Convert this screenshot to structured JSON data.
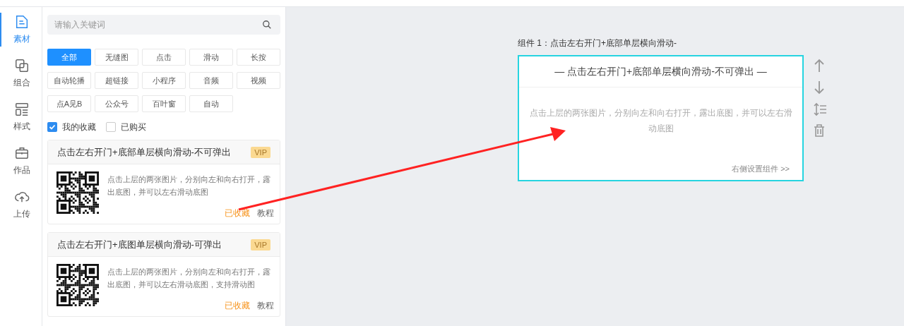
{
  "nav": [
    {
      "label": "素材",
      "selected": true,
      "kind": "file"
    },
    {
      "label": "组合",
      "selected": false,
      "kind": "combine"
    },
    {
      "label": "样式",
      "selected": false,
      "kind": "layout"
    },
    {
      "label": "作品",
      "selected": false,
      "kind": "briefcase"
    },
    {
      "label": "上传",
      "selected": false,
      "kind": "upload"
    }
  ],
  "search": {
    "placeholder": "请输入关键词"
  },
  "tags": [
    {
      "label": "全部",
      "selected": true
    },
    {
      "label": "无缝图",
      "selected": false
    },
    {
      "label": "点击",
      "selected": false
    },
    {
      "label": "滑动",
      "selected": false
    },
    {
      "label": "长按",
      "selected": false
    },
    {
      "label": "自动轮播",
      "selected": false
    },
    {
      "label": "超链接",
      "selected": false
    },
    {
      "label": "小程序",
      "selected": false
    },
    {
      "label": "音频",
      "selected": false
    },
    {
      "label": "视频",
      "selected": false
    },
    {
      "label": "点A见B",
      "selected": false
    },
    {
      "label": "公众号",
      "selected": false
    },
    {
      "label": "百叶窗",
      "selected": false
    },
    {
      "label": "自动",
      "selected": false
    }
  ],
  "filters": [
    {
      "label": "我的收藏",
      "checked": true
    },
    {
      "label": "已购买",
      "checked": false
    }
  ],
  "materials": [
    {
      "title": "点击左右开门+底部单层横向滑动-不可弹出",
      "badge": "VIP",
      "description": "点击上层的两张图片，分别向左和向右打开，露出底图，并可以左右滑动底图",
      "favorite": "已收藏",
      "tutorial": "教程"
    },
    {
      "title": "点击左右开门+底图单层横向滑动-可弹出",
      "badge": "VIP",
      "description": "点击上层的两张图片，分别向左和向右打开，露出底图，并可以左右滑动底图，支持滑动图",
      "favorite": "已收藏",
      "tutorial": "教程"
    }
  ],
  "component": {
    "label": "组件 1：点击左右开门+底部单层横向滑动-",
    "title": "— 点击左右开门+底部单层横向滑动-不可弹出 —",
    "description": "点击上层的两张图片，分别向左和向右打开，露出底图，并可以左右滑动底图",
    "link": "右侧设置组件 >>"
  }
}
